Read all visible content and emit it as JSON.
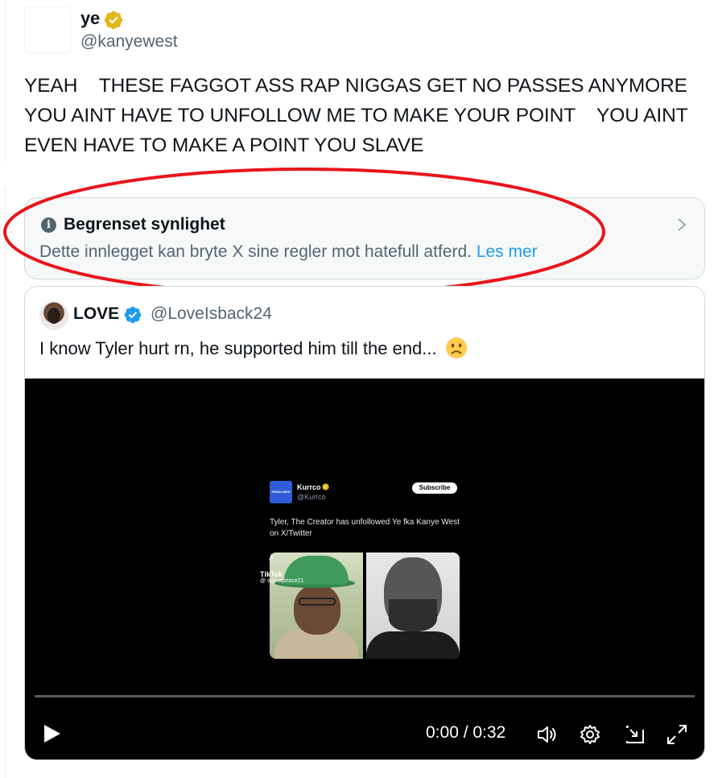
{
  "tweet": {
    "author_name": "ye",
    "author_handle": "@kanyewest",
    "text": "YEAH    THESE FAGGOT ASS RAP NIGGAS GET NO PASSES ANYMORE YOU AINT HAVE TO UNFOLLOW ME TO MAKE YOUR POINT    YOU AINT EVEN HAVE TO MAKE A POINT YOU SLAVE"
  },
  "notice": {
    "title": "Begrenset synlighet",
    "body": "Dette innlegget kan bryte X sine regler mot hatefull atferd.",
    "link": "Les mer",
    "annotation_color": "#e8151b"
  },
  "quote": {
    "author_name": "LOVE",
    "author_handle": "@LoveIsback24",
    "text": "I know Tyler hurt rn, he supported him till the end...",
    "emoji": "slightly-frowning-face"
  },
  "video": {
    "embed": {
      "logo_text": "HEADLINES",
      "name": "Kurrco",
      "handle": "@Kurrco",
      "subscribe": "Subscribe",
      "text": "Tyler, The Creator has unfollowed Ye fka Kanye West on X/Twitter"
    },
    "tiktok": {
      "label": "TikTok",
      "user": "@ sigmaprince21"
    },
    "time": "0:00 / 0:32",
    "progress": 0
  },
  "colors": {
    "gold_check": "#e2b719",
    "blue_check": "#1d9bf0",
    "link": "#1d9bf0"
  }
}
